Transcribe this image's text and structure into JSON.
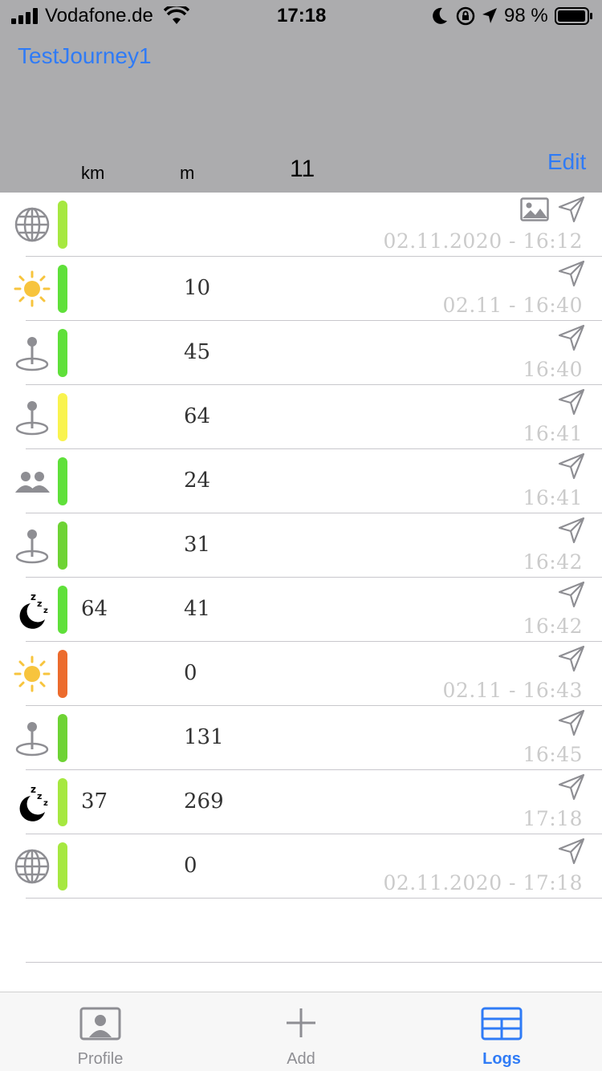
{
  "status_bar": {
    "carrier": "Vodafone.de",
    "time": "17:18",
    "battery": "98 %"
  },
  "header": {
    "title": "TestJourney1",
    "col_km": "km",
    "col_m": "m",
    "count": "11",
    "edit_label": "Edit"
  },
  "rows": [
    {
      "icon": "globe-icon",
      "bar_color": "#a6e840",
      "km": "",
      "m": "",
      "datetime": "02.11.2020 - 16:12",
      "photo": true
    },
    {
      "icon": "sun-icon",
      "bar_color": "#5fe03a",
      "km": "",
      "m": "10",
      "datetime": "02.11 - 16:40",
      "photo": false
    },
    {
      "icon": "pin-icon",
      "bar_color": "#5fe03a",
      "km": "",
      "m": "45",
      "datetime": "16:40",
      "photo": false
    },
    {
      "icon": "pin-icon",
      "bar_color": "#f9f34e",
      "km": "",
      "m": "64",
      "datetime": "16:41",
      "photo": false
    },
    {
      "icon": "people-icon",
      "bar_color": "#5fe03a",
      "km": "",
      "m": "24",
      "datetime": "16:41",
      "photo": false
    },
    {
      "icon": "pin-icon",
      "bar_color": "#6ed334",
      "km": "",
      "m": "31",
      "datetime": "16:42",
      "photo": false
    },
    {
      "icon": "sleep-moon-icon",
      "bar_color": "#5fe03a",
      "km": "64",
      "m": "41",
      "datetime": "16:42",
      "photo": false
    },
    {
      "icon": "sun-icon",
      "bar_color": "#ec6b2d",
      "km": "",
      "m": "0",
      "datetime": "02.11 - 16:43",
      "photo": false
    },
    {
      "icon": "pin-icon",
      "bar_color": "#6ed334",
      "km": "",
      "m": "131",
      "datetime": "16:45",
      "photo": false
    },
    {
      "icon": "sleep-moon-icon",
      "bar_color": "#a6e840",
      "km": "37",
      "m": "269",
      "datetime": "17:18",
      "photo": false
    },
    {
      "icon": "globe-icon",
      "bar_color": "#a6e840",
      "km": "",
      "m": "0",
      "datetime": "02.11.2020 - 17:18",
      "photo": false
    }
  ],
  "tabs": [
    {
      "label": "Profile",
      "icon": "profile-icon",
      "active": false
    },
    {
      "label": "Add",
      "icon": "plus-icon",
      "active": false
    },
    {
      "label": "Logs",
      "icon": "table-icon",
      "active": true
    }
  ],
  "colors": {
    "accent": "#2f7bf6",
    "header_bg": "#acacae",
    "inactive_tab": "#8e8e93"
  }
}
